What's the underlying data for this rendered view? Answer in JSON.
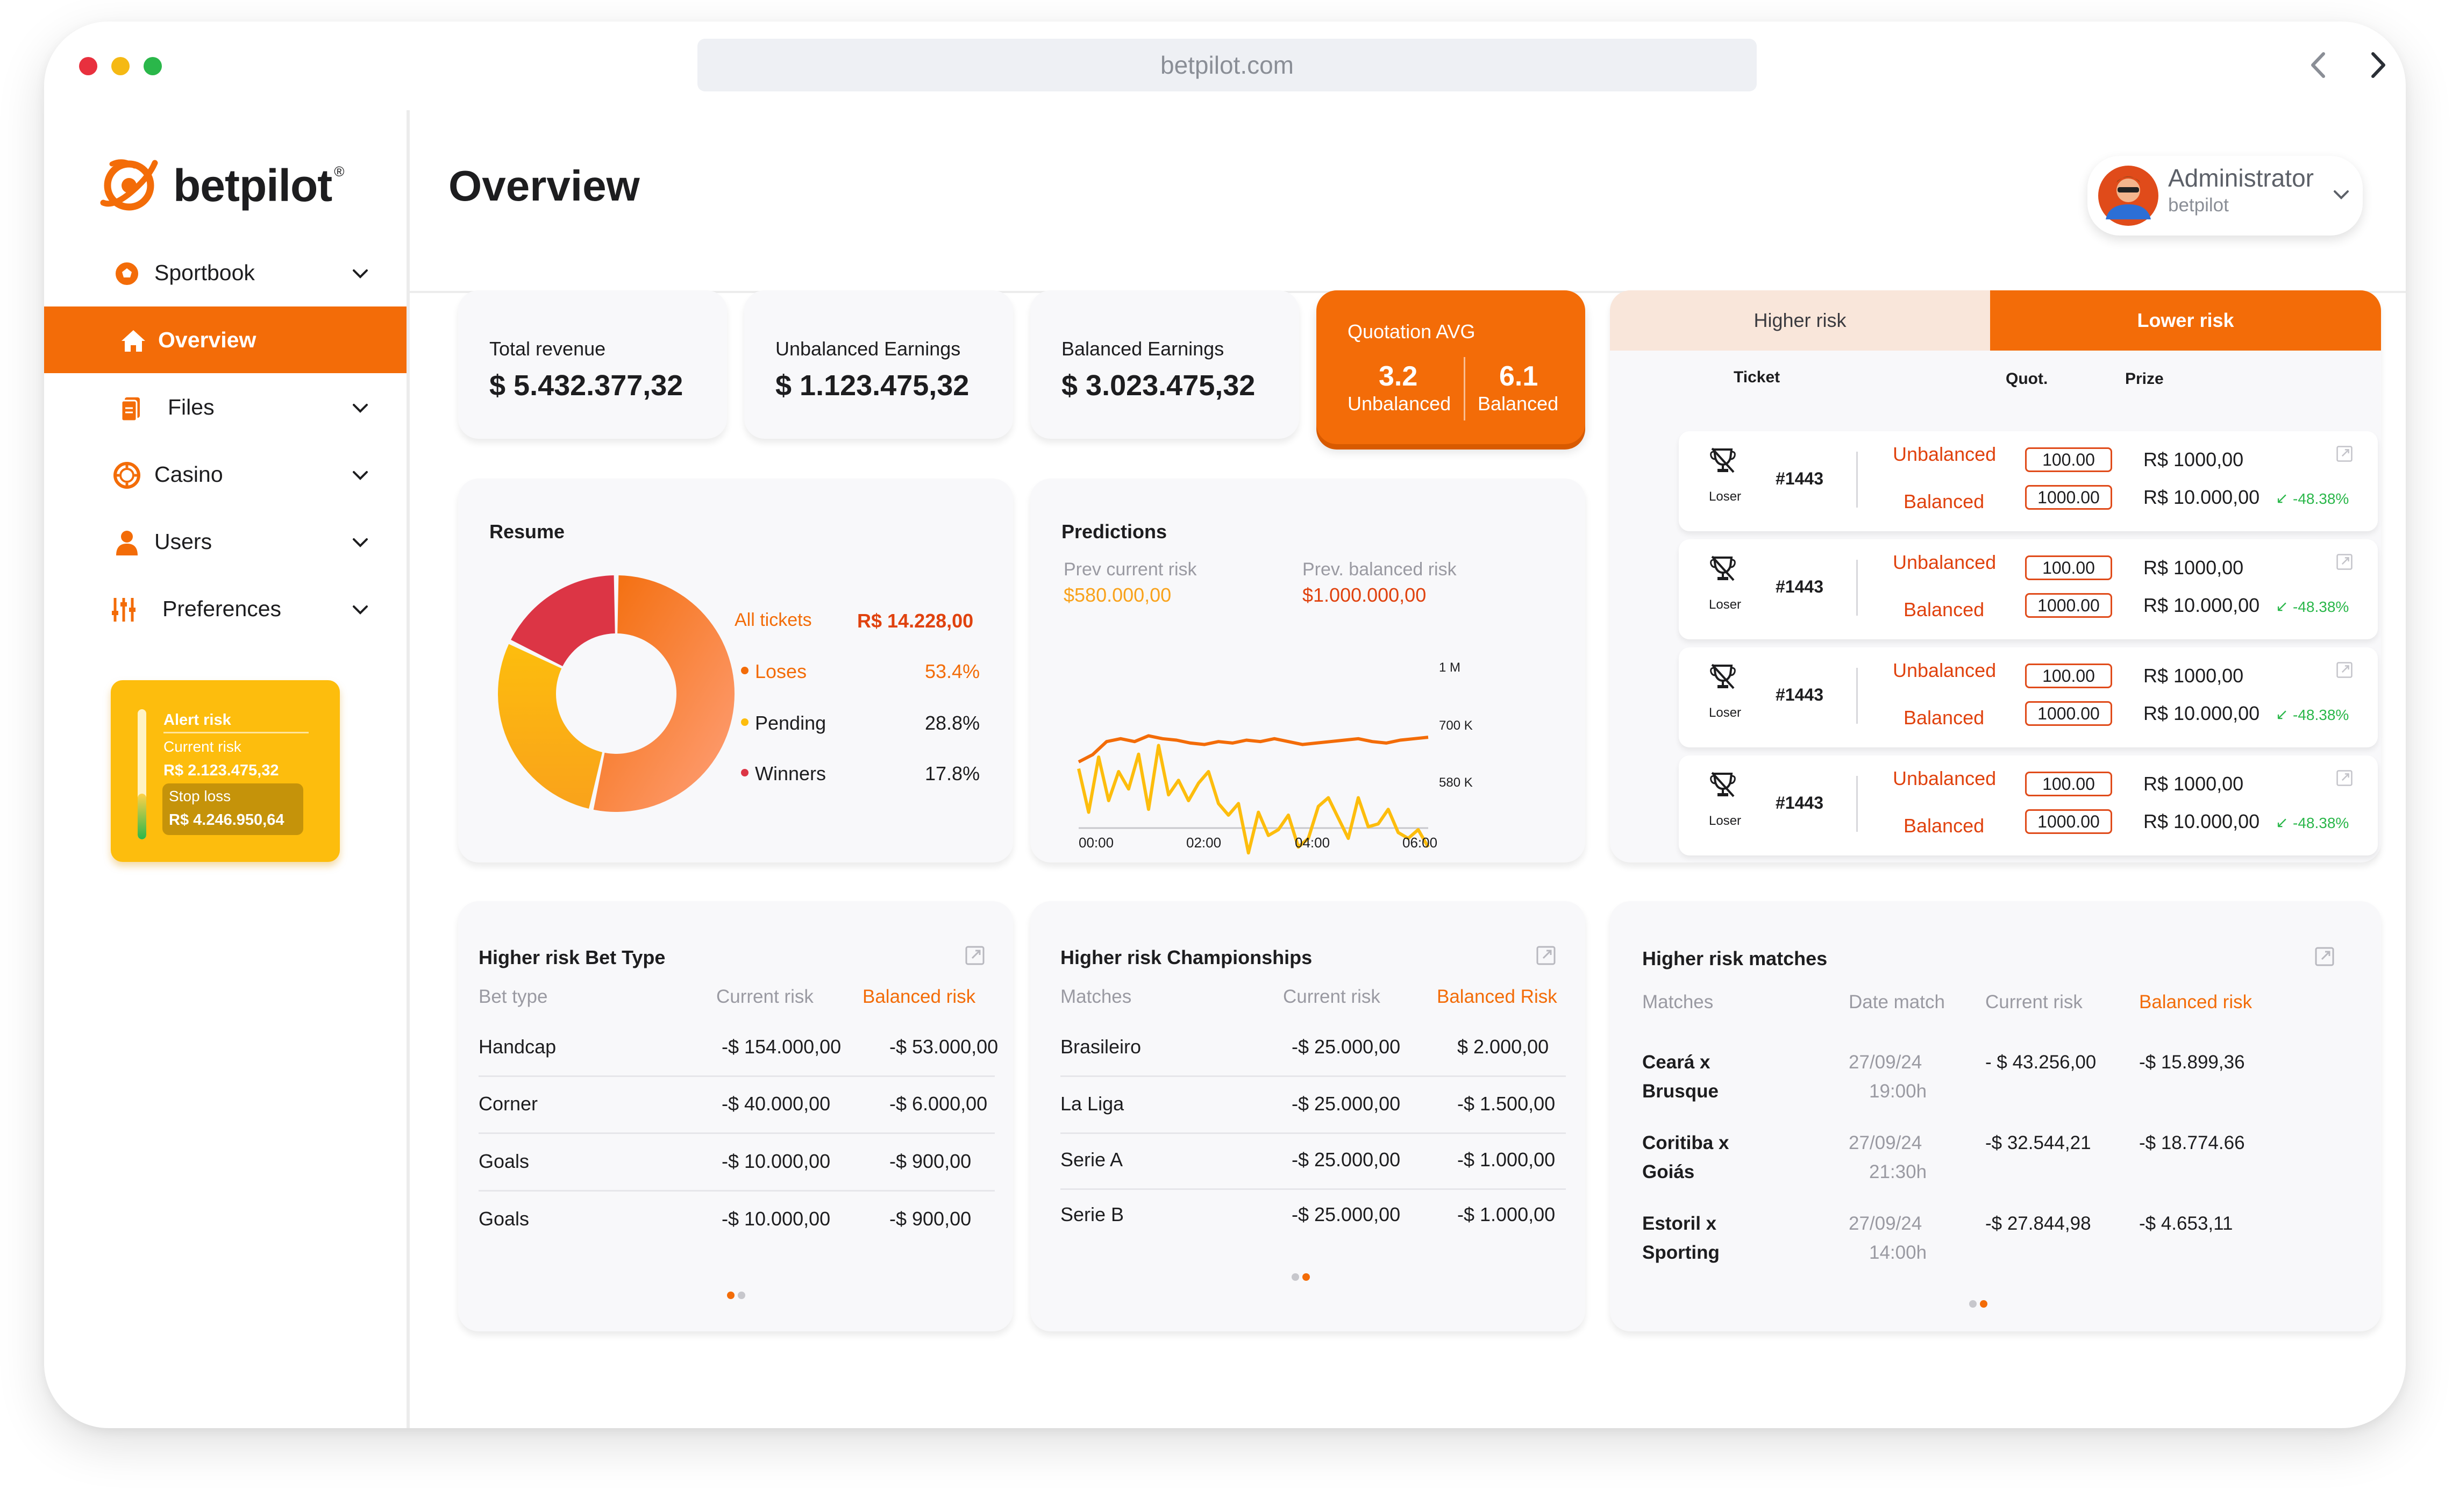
{
  "browser": {
    "url": "betpilot.com"
  },
  "logo": {
    "name": "betpilot",
    "reg": "®"
  },
  "nav": [
    {
      "label": "Sportbook",
      "icon": "soccer-ball-icon"
    },
    {
      "label": "Overview",
      "icon": "home-icon"
    },
    {
      "label": "Files",
      "icon": "file-icon"
    },
    {
      "label": "Casino",
      "icon": "casino-chip-icon"
    },
    {
      "label": "Users",
      "icon": "user-icon"
    },
    {
      "label": "Preferences",
      "icon": "sliders-icon"
    }
  ],
  "alert": {
    "title": "Alert risk",
    "current_label": "Current risk",
    "current_value": "R$ 2.123.475,32",
    "stop_label": "Stop loss",
    "stop_value": "R$ 4.246.950,64",
    "level": 0.35
  },
  "page": {
    "title": "Overview"
  },
  "user": {
    "name": "Administrator",
    "org": "betpilot"
  },
  "stats": [
    {
      "label": "Total revenue",
      "value": "$ 5.432.377,32"
    },
    {
      "label": "Unbalanced Earnings",
      "value": "$ 1.123.475,32"
    },
    {
      "label": "Balanced Earnings",
      "value": "$ 3.023.475,32"
    }
  ],
  "quotation": {
    "label": "Quotation AVG",
    "unbalanced_value": "3.2",
    "unbalanced_label": "Unbalanced",
    "balanced_value": "6.1",
    "balanced_label": "Balanced"
  },
  "risk_tabs": {
    "higher": "Higher risk",
    "lower": "Lower risk"
  },
  "tickets_header": {
    "ticket": "Ticket",
    "quot": "Quot.",
    "prize": "Prize"
  },
  "tickets": [
    {
      "status": "Loser",
      "id": "#1443",
      "unbalanced": "Unbalanced",
      "balanced": "Balanced",
      "q1": "100.00",
      "q2": "1000.00",
      "p1": "R$ 1000,00",
      "p2": "R$ 10.000,00",
      "change": "-48.38%"
    },
    {
      "status": "Loser",
      "id": "#1443",
      "unbalanced": "Unbalanced",
      "balanced": "Balanced",
      "q1": "100.00",
      "q2": "1000.00",
      "p1": "R$ 1000,00",
      "p2": "R$ 10.000,00",
      "change": "-48.38%"
    },
    {
      "status": "Loser",
      "id": "#1443",
      "unbalanced": "Unbalanced",
      "balanced": "Balanced",
      "q1": "100.00",
      "q2": "1000.00",
      "p1": "R$ 1000,00",
      "p2": "R$ 10.000,00",
      "change": "-48.38%"
    },
    {
      "status": "Loser",
      "id": "#1443",
      "unbalanced": "Unbalanced",
      "balanced": "Balanced",
      "q1": "100.00",
      "q2": "1000.00",
      "p1": "R$ 1000,00",
      "p2": "R$ 10.000,00",
      "change": "-48.38%"
    }
  ],
  "resume": {
    "title": "Resume",
    "all_label": "All tickets",
    "all_value": "R$ 14.228,00",
    "items": [
      {
        "label": "Loses",
        "value": "53.4%"
      },
      {
        "label": "Pending",
        "value": "28.8%"
      },
      {
        "label": "Winners",
        "value": "17.8%"
      }
    ]
  },
  "chart_data": [
    {
      "type": "pie",
      "title": "Resume",
      "labels": [
        "Loses",
        "Pending",
        "Winners"
      ],
      "values": [
        53.4,
        28.8,
        17.8
      ],
      "colors": [
        "#f36c08",
        "#fdbd0d",
        "#dc3545"
      ]
    },
    {
      "type": "line",
      "title": "Predictions",
      "x": [
        "00:00",
        "00:30",
        "01:00",
        "01:30",
        "02:00",
        "02:30",
        "03:00",
        "03:30",
        "04:00",
        "04:30",
        "05:00",
        "05:30",
        "06:00",
        "06:30"
      ],
      "x_ticks": [
        "00:00",
        "02:00",
        "04:00",
        "06:00"
      ],
      "y_ticks": [
        "1 M",
        "700 K",
        "580 K"
      ],
      "series": [
        {
          "name": "Prev current risk",
          "value": "$580.000,00",
          "color": "#f36c08"
        },
        {
          "name": "Prev. balanced risk",
          "value": "$1.000.000,00",
          "color": "#fdbd0d"
        }
      ]
    }
  ],
  "predictions": {
    "title": "Predictions",
    "legend": [
      {
        "label": "Prev current risk",
        "value": "$580.000,00"
      },
      {
        "label": "Prev. balanced risk",
        "value": "$1.000.000,00"
      }
    ],
    "x_ticks": [
      "00:00",
      "02:00",
      "04:00",
      "06:00"
    ],
    "y_ticks": [
      "1 M",
      "700 K",
      "580 K"
    ]
  },
  "bet_type": {
    "title": "Higher risk Bet Type",
    "columns": [
      "Bet type",
      "Current risk",
      "Balanced risk"
    ],
    "rows": [
      [
        "Handcap",
        "-$ 154.000,00",
        "-$ 53.000,00"
      ],
      [
        "Corner",
        "-$ 40.000,00",
        "-$ 6.000,00"
      ],
      [
        "Goals",
        "-$ 10.000,00",
        "-$ 900,00"
      ],
      [
        "Goals",
        "-$ 10.000,00",
        "-$ 900,00"
      ]
    ]
  },
  "championships": {
    "title": "Higher risk Championships",
    "columns": [
      "Matches",
      "Current risk",
      "Balanced Risk"
    ],
    "rows": [
      [
        "Brasileiro",
        "-$ 25.000,00",
        "$ 2.000,00"
      ],
      [
        "La Liga",
        "-$ 25.000,00",
        "-$ 1.500,00"
      ],
      [
        "Serie A",
        "-$ 25.000,00",
        "-$ 1.000,00"
      ],
      [
        "Serie B",
        "-$ 25.000,00",
        "-$ 1.000,00"
      ]
    ]
  },
  "matches": {
    "title": "Higher risk matches",
    "columns": [
      "Matches",
      "Date match",
      "Current risk",
      "Balanced risk"
    ],
    "rows": [
      {
        "team1": "Ceará x",
        "team2": "Brusque",
        "date": "27/09/24",
        "time": "19:00h",
        "current": "- $ 43.256,00",
        "balanced": "-$ 15.899,36"
      },
      {
        "team1": "Coritiba x",
        "team2": "Goiás",
        "date": "27/09/24",
        "time": "21:30h",
        "current": "-$ 32.544,21",
        "balanced": "-$ 18.774.66"
      },
      {
        "team1": "Estoril x",
        "team2": "Sporting",
        "date": "27/09/24",
        "time": "14:00h",
        "current": "-$ 27.844,98",
        "balanced": "-$ 4.653,11"
      }
    ]
  }
}
